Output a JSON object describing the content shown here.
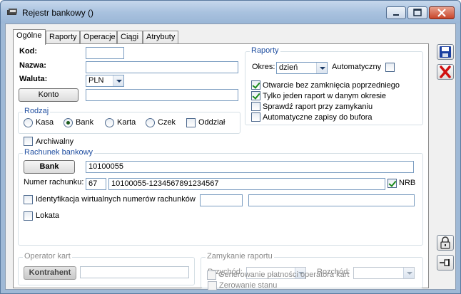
{
  "window": {
    "title": "Rejestr bankowy ()",
    "minimize_icon": "minimize-icon",
    "maximize_icon": "maximize-icon",
    "close_icon": "close-icon"
  },
  "tabs": [
    {
      "label": "Ogólne",
      "active": true
    },
    {
      "label": "Raporty"
    },
    {
      "label": "Operacje"
    },
    {
      "label": "Ciągi"
    },
    {
      "label": "Atrybuty"
    }
  ],
  "general": {
    "kod_label": "Kod:",
    "kod_value": "",
    "nazwa_label": "Nazwa:",
    "nazwa_value": "",
    "waluta_label": "Waluta:",
    "waluta_value": "PLN",
    "konto_button": "Konto",
    "konto_value": ""
  },
  "rodzaj": {
    "title": "Rodzaj",
    "options": [
      "Kasa",
      "Bank",
      "Karta",
      "Czek"
    ],
    "selected": "Bank",
    "oddzial_label": "Oddział",
    "oddzial_checked": false
  },
  "archiwalny": {
    "label": "Archiwalny",
    "checked": false
  },
  "raporty": {
    "title": "Raporty",
    "okres_label": "Okres:",
    "okres_value": "dzień",
    "automatyczny_label": "Automatyczny",
    "automatyczny_checked": false,
    "options": [
      {
        "label": "Otwarcie bez zamknięcia poprzedniego",
        "checked": true
      },
      {
        "label": "Tylko jeden raport w danym okresie",
        "checked": true
      },
      {
        "label": "Sprawdź raport przy zamykaniu",
        "checked": false
      },
      {
        "label": "Automatyczne zapisy do bufora",
        "checked": false
      }
    ]
  },
  "rachunek": {
    "title": "Rachunek bankowy",
    "bank_button": "Bank",
    "bank_value": "10100055",
    "numer_label": "Numer rachunku:",
    "numer_prefix": "67",
    "numer_value": "10100055-1234567891234567",
    "nrb_label": "NRB",
    "nrb_checked": true,
    "identyfikacja_label": "Identyfikacja wirtualnych numerów rachunków",
    "identyfikacja_checked": false,
    "identyfikacja_value1": "",
    "identyfikacja_value2": "",
    "lokata_label": "Lokata",
    "lokata_checked": false
  },
  "operator": {
    "title": "Operator kart",
    "button": "Kontrahent",
    "value": ""
  },
  "zamykanie": {
    "title": "Zamykanie raportu",
    "przychod_label": "Przychód:",
    "rozchod_label": "Rozchód:",
    "zerowanie_label": "Zerowanie stanu",
    "generowanie_label": "Generowanie płatności operatora kart"
  },
  "sidebar": {
    "save_icon": "save-icon",
    "cancel_icon": "cancel-icon",
    "lock_icon": "lock-icon",
    "pin_icon": "pin-icon"
  }
}
